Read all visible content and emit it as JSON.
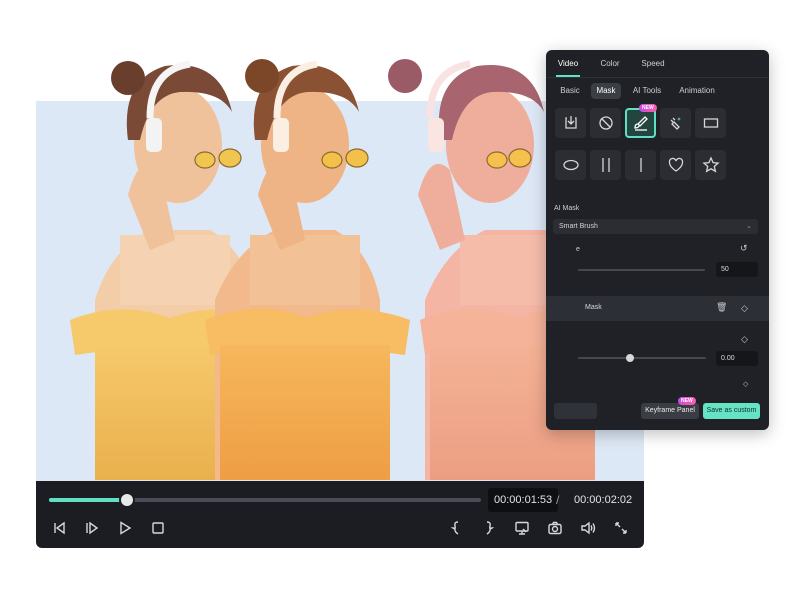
{
  "player": {
    "progress": 0.18,
    "current_time": "00:00:01:53",
    "separator": "/",
    "total_time": "00:00:02:02",
    "controls": [
      "prev-frame-icon",
      "next-frame-icon",
      "play-icon",
      "stop-icon",
      "mark-in-icon",
      "mark-out-icon",
      "snapshot-export-icon",
      "camera-icon",
      "volume-icon",
      "fullscreen-icon"
    ]
  },
  "panel": {
    "tabs": [
      {
        "label": "Video",
        "active": true
      },
      {
        "label": "Color",
        "active": false
      },
      {
        "label": "Speed",
        "active": false
      }
    ],
    "subtabs": [
      {
        "label": "Basic",
        "active": false
      },
      {
        "label": "Mask",
        "active": true
      },
      {
        "label": "AI Tools",
        "active": false
      },
      {
        "label": "Animation",
        "active": false
      }
    ],
    "shapes": [
      "import-mask-icon",
      "no-mask-icon",
      "brush-mask-icon",
      "ai-mask-icon",
      "rectangle-icon",
      "ellipse-icon",
      "double-line-icon",
      "single-line-icon",
      "heart-icon",
      "star-icon"
    ],
    "new_badge_1": "NEW",
    "new_badge_2": "NEW",
    "ai_mask_label": "AI Mask",
    "ai_mask_value": "Smart Brush",
    "size_label_fragment": "e",
    "size_value": "50",
    "mask_row_label": "Mask",
    "blur_value": "0.00",
    "keyframe_button": "Keyframe Panel",
    "save_button": "Save as custom",
    "accent": "#61e2c7"
  }
}
